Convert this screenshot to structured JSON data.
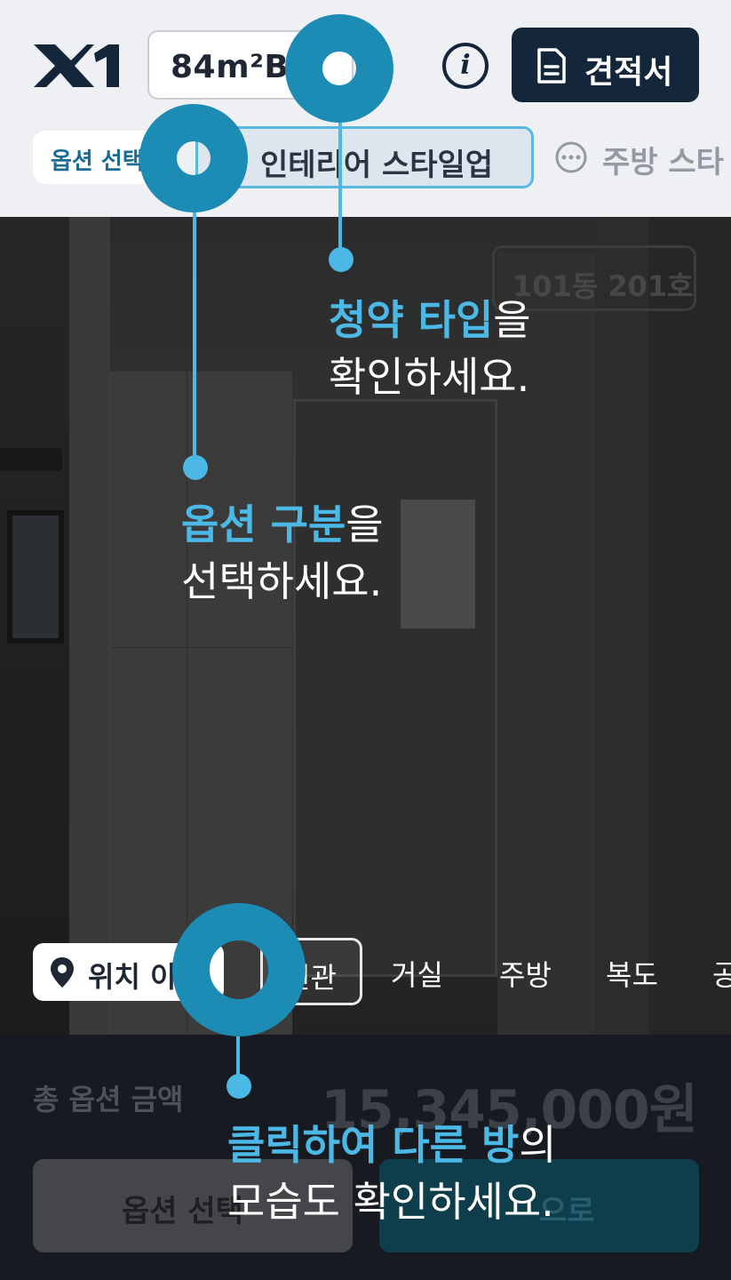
{
  "header": {
    "logo_text": "X1",
    "type_select": {
      "value": "84m²B"
    },
    "info_button_icon": "info-icon",
    "quote_button": {
      "label": "견적서",
      "icon": "document-icon"
    }
  },
  "option_nav": {
    "select_label": "옵션 선택",
    "chips": [
      {
        "label": "인테리어 스타일업",
        "icon": "palette-icon",
        "active": true
      },
      {
        "label": "주방 스타",
        "icon": "more-icon",
        "active": false
      }
    ]
  },
  "photo": {
    "unit_label": "101동 201호"
  },
  "room_nav": {
    "location_button": {
      "label": "위치 이동",
      "icon": "map-pin-icon"
    },
    "rooms": [
      {
        "label": "현관",
        "active": true
      },
      {
        "label": "거실",
        "active": false
      },
      {
        "label": "주방",
        "active": false
      },
      {
        "label": "복도",
        "active": false
      },
      {
        "label": "공",
        "active": false
      }
    ]
  },
  "summary": {
    "total_label": "총 옵션 금액",
    "total_amount": "15,345,000원",
    "left_button": "옵션 선택",
    "right_button": "으로"
  },
  "coach_marks": {
    "type_tip": {
      "highlight": "청약 타입",
      "suffix": "을",
      "line2": "확인하세요."
    },
    "option_tip": {
      "highlight": "옵션 구분",
      "suffix": "을",
      "line2": "선택하세요."
    },
    "room_tip": {
      "highlight": "클릭하여 다른 방",
      "suffix": "의",
      "line2": "모습도 확인하세요."
    }
  },
  "colors": {
    "navy": "#14263a",
    "accent": "#4cb8e6",
    "ring": "#1c8cb4",
    "header_bg": "#eff0f4"
  }
}
